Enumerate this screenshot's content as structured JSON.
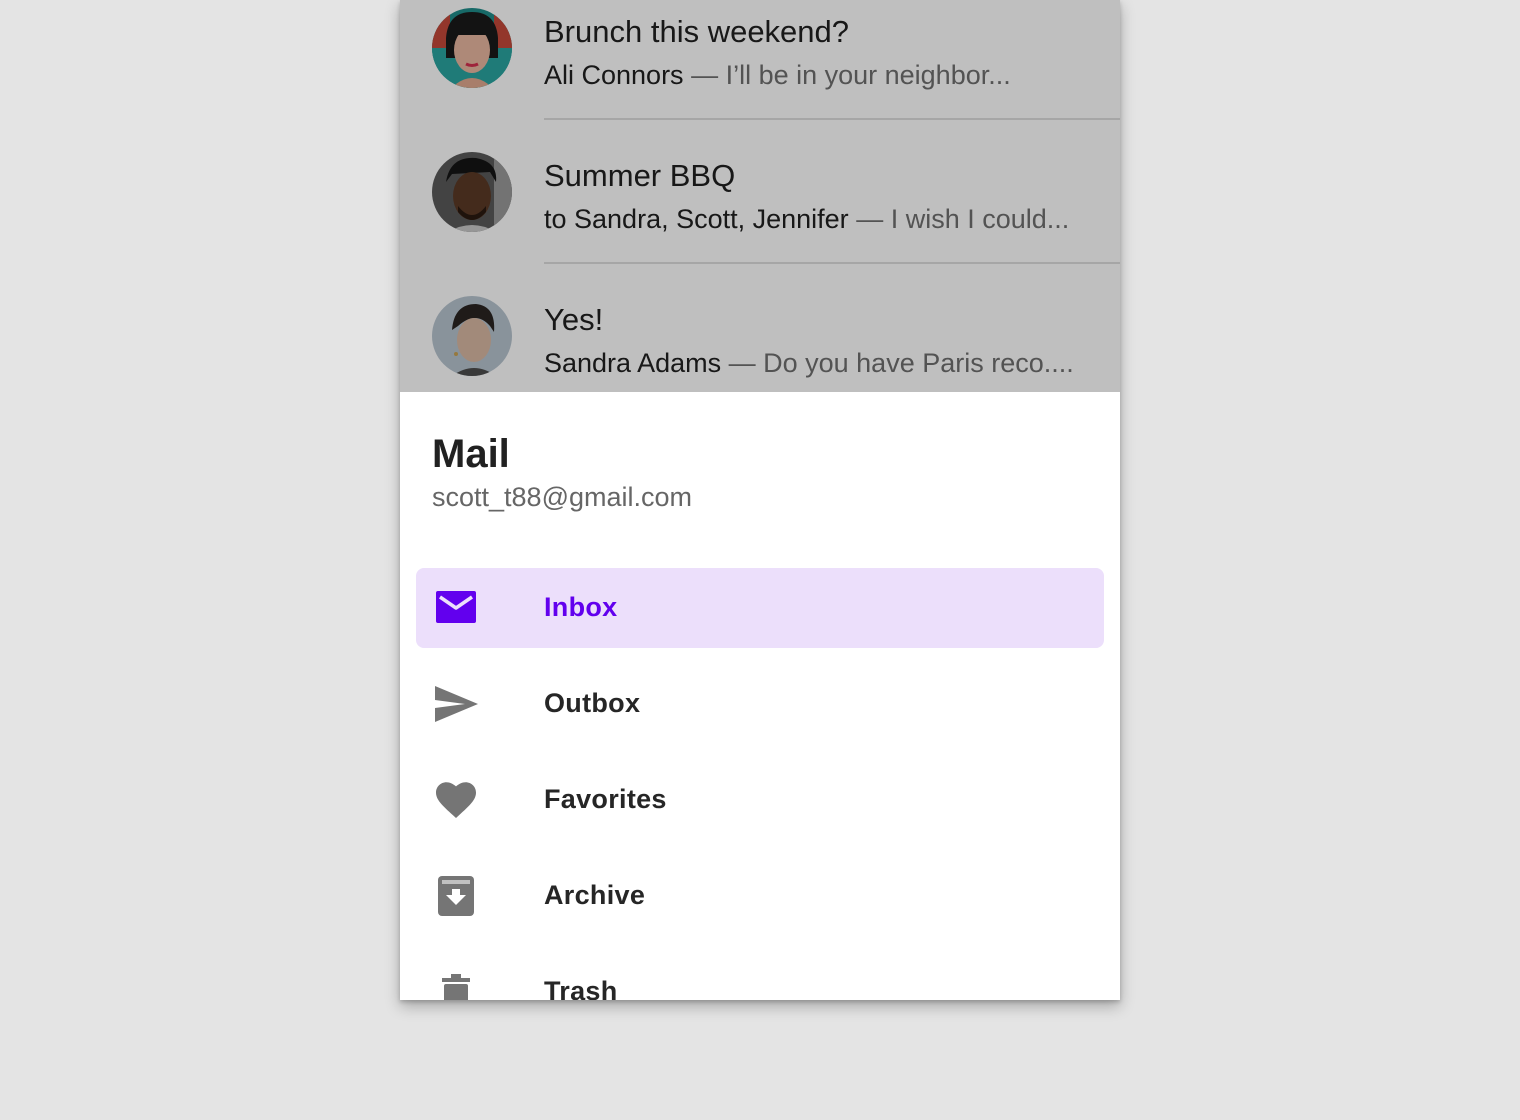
{
  "emails": [
    {
      "subject": "Brunch this weekend?",
      "sender": "Ali Connors",
      "preview": " — I’ll be in your neighbor..."
    },
    {
      "subject": "Summer BBQ",
      "sender": "to Sandra, Scott, Jennifer",
      "preview": " — I wish I could..."
    },
    {
      "subject": "Yes!",
      "sender": "Sandra Adams",
      "preview": " — Do you have Paris reco...."
    }
  ],
  "drawer": {
    "title": "Mail",
    "account": "scott_t88@gmail.com",
    "items": [
      {
        "label": "Inbox",
        "icon": "mail-icon",
        "active": true
      },
      {
        "label": "Outbox",
        "icon": "send-icon",
        "active": false
      },
      {
        "label": "Favorites",
        "icon": "heart-icon",
        "active": false
      },
      {
        "label": "Archive",
        "icon": "archive-icon",
        "active": false
      },
      {
        "label": "Trash",
        "icon": "trash-icon",
        "active": false
      }
    ]
  },
  "colors": {
    "accent": "#6200ee",
    "active_bg": "#ecdffb",
    "icon_gray": "#757575",
    "scrim": "rgba(0,0,0,0.25)"
  }
}
